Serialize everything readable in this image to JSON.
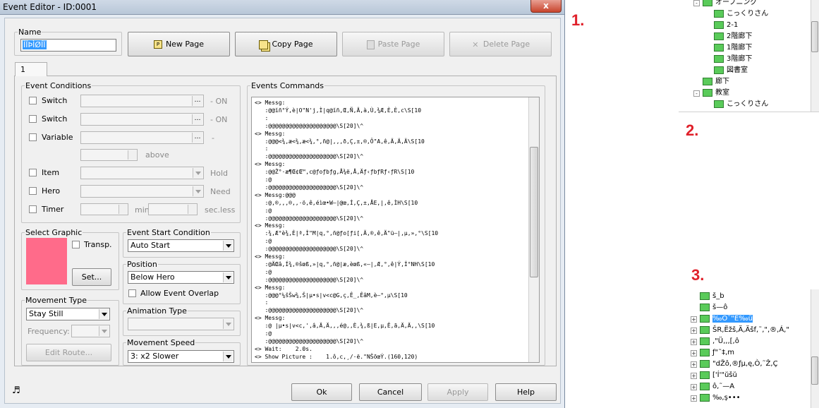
{
  "window": {
    "title": "Event Editor - ID:0001",
    "close_label": "x"
  },
  "name_group": {
    "legend": "Name",
    "value": "ÌÏÞÌØÍÏ"
  },
  "page_buttons": {
    "new": "New Page",
    "copy": "Copy Page",
    "paste": "Paste Page",
    "delete": "Delete Page"
  },
  "tab": {
    "label": "1"
  },
  "conditions": {
    "legend": "Event Conditions",
    "switch1": {
      "label": "Switch",
      "suffix": "- ON"
    },
    "switch2": {
      "label": "Switch",
      "suffix": "- ON"
    },
    "variable": {
      "label": "Variable",
      "suffix": "-",
      "compare": "above"
    },
    "item": {
      "label": "Item",
      "suffix": "Hold"
    },
    "hero": {
      "label": "Hero",
      "suffix": "Need"
    },
    "timer": {
      "label": "Timer",
      "min": "min",
      "sec": "sec.less"
    }
  },
  "graphic": {
    "legend": "Select Graphic",
    "transp": "Transp.",
    "set": "Set...",
    "color": "#ff6b8a"
  },
  "start_condition": {
    "legend": "Event Start Condition",
    "value": "Auto Start"
  },
  "position": {
    "legend": "Position",
    "value": "Below Hero",
    "overlap": "Allow Event Overlap"
  },
  "animation": {
    "legend": "Animation Type",
    "value": ""
  },
  "movement": {
    "legend": "Movement Type",
    "value": "Stay Still",
    "frequency": "Frequency:",
    "edit_route": "Edit Route..."
  },
  "speed": {
    "legend": "Movement Speed",
    "value": "3: x2 Slower"
  },
  "commands": {
    "legend": "Events Commands",
    "lines": [
      "<> Messg:",
      "   :@@ĭñ°Ý,è|O\"N'j,Ì|q@ĭñ,Œ,Ñ,Ä,à,Ù,¾Æ,È,È,c\\S[10",
      "   :",
      "   :@@@@@@@@@@@@@@@@@@@@\\S[20]\\^",
      "<> Messg:",
      "   :@@@<¾,æ<¾,æ<¾,°,ñ@|,,,ð,Ç,±,®,Ö\"A,ê,Ä,Ä,Ä\\S[10",
      "   :",
      "   :@@@@@@@@@@@@@@@@@@@@\\S[20]\\^",
      "<> Messg:",
      "   :@@Ž°·æ¶Œ¢Œ™,c@ƒoƒbƒg,Å¾ë,Å,Äƒ‹ƒbƒRƒ‹ƒR\\S[10",
      "   :@",
      "   :@@@@@@@@@@@@@@@@@@@@\\S[20]\\^",
      "<> Messg:@@@",
      "   :@,®,,,®,,·ö,ê,éìœ•W—|@œ,Í,Ç,±,ÅE,|,ê,ÌH\\S[10",
      "   :@",
      "   :@@@@@@@@@@@@@@@@@@@@\\S[20]\\^",
      "<> Messg:",
      "   :¾,Æ°è¾,È|ª,Ì\"M|q,°,ñ@ƒo[ƒi[,Ä,®,ê,Ä\"ü—|,µ,»,°\\S[10",
      "   :@",
      "   :@@@@@@@@@@@@@@@@@@@@\\S[20]\\^",
      "<> Messg:",
      "   :@ÄŒâ,Í¾,®šœß,»|q,°,ñ@|æ,èœß,«—|,Æ,°,ê|Ý,Í°NH\\S[10",
      "   :@",
      "   :@@@@@@@@@@@@@@@@@@@@\\S[20]\\^",
      "<> Messg:",
      "   :@@@°¼šŠw¾,Š|µ•s|v<c@G,ç,Ê_,ÊâM,è—°,µ\\S[10",
      "   :",
      "   :@@@@@@@@@@@@@@@@@@@@\\S[20]\\^",
      "<> Messg:",
      "   :@ |µ•s|v<c,',â,Ä,Ä,,,é@,,È,¾,ß|E,µ,Ê,ã,Ä,Ä,,\\S[10",
      "   :@",
      "   :@@@@@@@@@@@@@@@@@@@@\\S[20]\\^",
      "<> Wait:    2.0s.",
      "<> Show Picture :    1.ô,c,¸/·ë.\"NŠõœÝ.(160,120)"
    ]
  },
  "bottom": {
    "ok": "Ok",
    "cancel": "Cancel",
    "apply": "Apply",
    "help": "Help",
    "music_icon": "music-note-icon"
  },
  "markers": {
    "one": "1.",
    "two": "2.",
    "three": "3."
  },
  "tree1": {
    "items": [
      {
        "label": "オープニング",
        "level": 1,
        "expand": "-"
      },
      {
        "label": "こっくりさん",
        "level": 2
      },
      {
        "label": "2-1",
        "level": 2
      },
      {
        "label": "2階廊下",
        "level": 2
      },
      {
        "label": "1階廊下",
        "level": 2
      },
      {
        "label": "3階廊下",
        "level": 2
      },
      {
        "label": "図書室",
        "level": 2
      },
      {
        "label": "廊下",
        "level": 1
      },
      {
        "label": "教室",
        "level": 1,
        "expand": "-"
      },
      {
        "label": "こっくりさん",
        "level": 2
      }
    ]
  },
  "tree2": {
    "items": [
      {
        "label": "š_b",
        "level": 1
      },
      {
        "label": "š—ô",
        "level": 1
      },
      {
        "label": "‰Ö˜\"E‰ü",
        "level": 1,
        "selected": true,
        "expand": "+"
      },
      {
        "label": "ŠR,Ёžš,Ä,Äšf,˜,\",®,Á,\"",
        "level": 1,
        "expand": "+"
      },
      {
        "label": ",\"Ü,,,[,ô",
        "level": 1,
        "expand": "+"
      },
      {
        "label": "ƒ\"˜‡,m",
        "level": 1,
        "expand": "+"
      },
      {
        "label": "\"dŽô,®ƒµ,ę,Ò,˜Ž,Ç",
        "level": 1,
        "expand": "+"
      },
      {
        "label": "['Í'\"ŭšŭ",
        "level": 1,
        "expand": "+"
      },
      {
        "label": "ô,˜—A",
        "level": 1,
        "expand": "+"
      },
      {
        "label": "‰,ș•••",
        "level": 1,
        "expand": "+"
      }
    ]
  }
}
